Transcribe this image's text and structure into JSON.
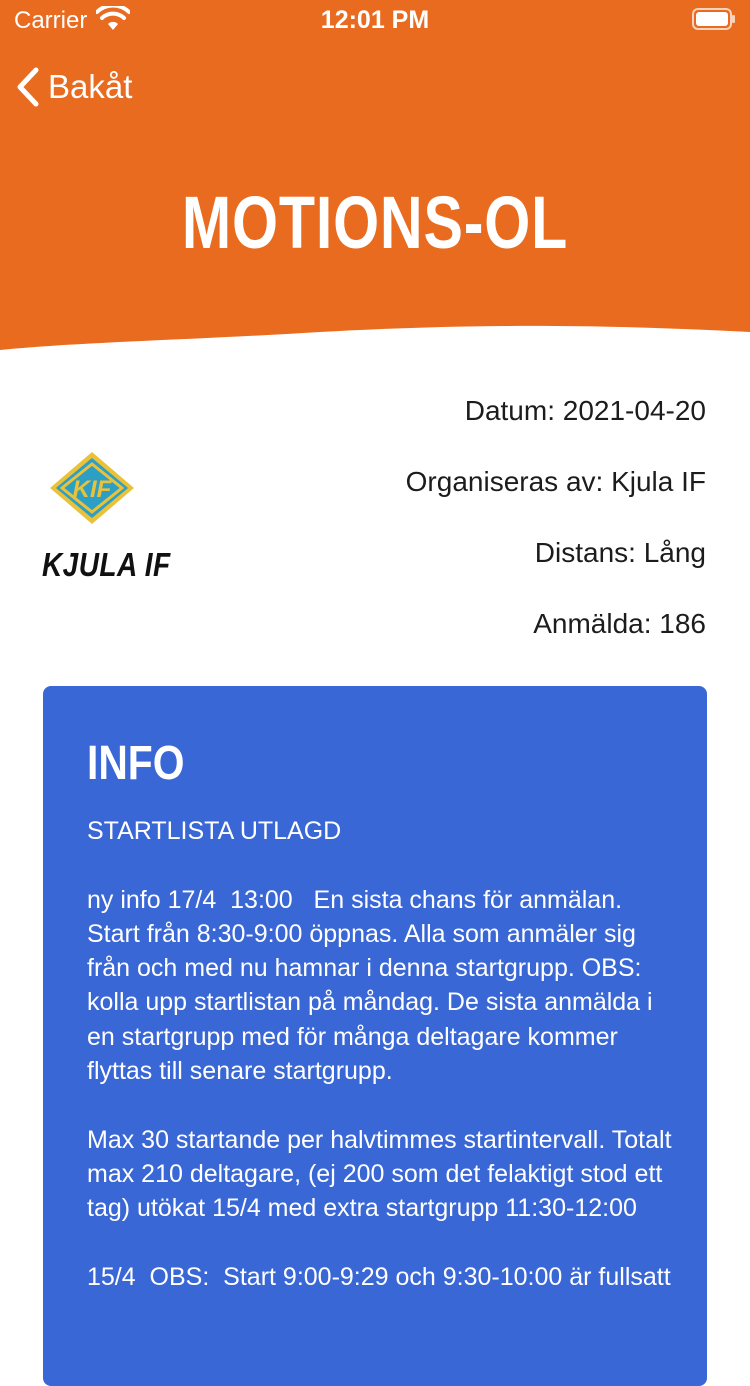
{
  "status_bar": {
    "carrier": "Carrier",
    "time": "12:01 PM"
  },
  "nav": {
    "back_label": "Bakåt"
  },
  "page": {
    "title": "MOTIONS-OL"
  },
  "event": {
    "date": "Datum: 2021-04-20",
    "organizer": "Organiseras av: Kjula IF",
    "distance": "Distans: Lång",
    "registered": "Anmälda: 186"
  },
  "club": {
    "name": "KJULA IF",
    "logo_text": "KIF"
  },
  "info": {
    "title": "INFO",
    "text": "STARTLISTA UTLAGD\n\nny info 17/4  13:00   En sista chans för anmälan. Start från 8:30-9:00 öppnas. Alla som anmäler sig från och med nu hamnar i denna startgrupp. OBS: kolla upp startlistan på måndag. De sista anmälda i en startgrupp med för många deltagare kommer flyttas till senare startgrupp.\n\nMax 30 startande per halvtimmes startintervall. Totalt max 210 deltagare, (ej 200 som det felaktigt stod ett tag) utökat 15/4 med extra startgrupp 11:30-12:00\n\n15/4  OBS:  Start 9:00-9:29 och 9:30-10:00 är fullsatt"
  },
  "colors": {
    "header": "#E96B20",
    "info_card": "#3A67D6",
    "logo_yellow": "#E9C23A",
    "logo_teal": "#2E9FC4"
  }
}
